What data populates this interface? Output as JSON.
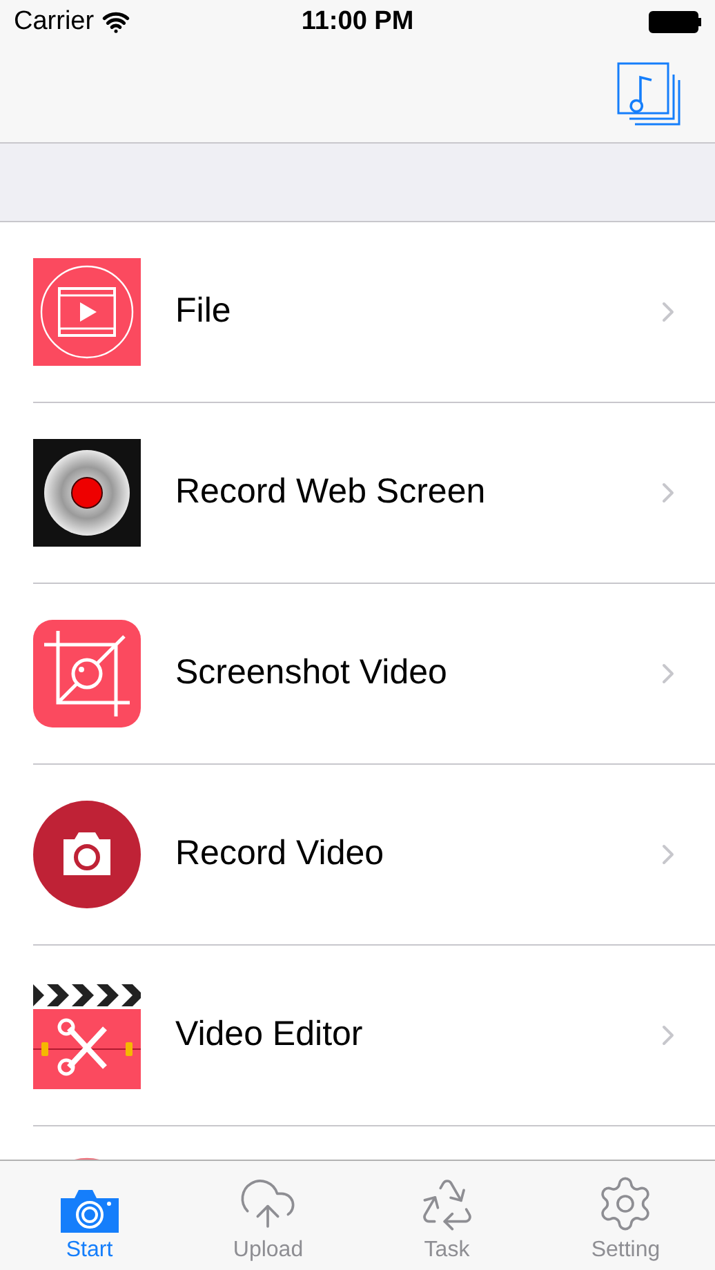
{
  "status_bar": {
    "carrier": "Carrier",
    "time": "11:00 PM"
  },
  "menu": [
    {
      "kind": "film",
      "label": "File"
    },
    {
      "kind": "record",
      "label": "Record Web Screen"
    },
    {
      "kind": "crop",
      "label": "Screenshot Video"
    },
    {
      "kind": "camera",
      "label": "Record Video"
    },
    {
      "kind": "clapper",
      "label": "Video Editor"
    }
  ],
  "tabs": [
    {
      "kind": "camera",
      "label": "Start",
      "selected": true
    },
    {
      "kind": "upload",
      "label": "Upload",
      "selected": false
    },
    {
      "kind": "recycle",
      "label": "Task",
      "selected": false
    },
    {
      "kind": "gear",
      "label": "Setting",
      "selected": false
    }
  ]
}
